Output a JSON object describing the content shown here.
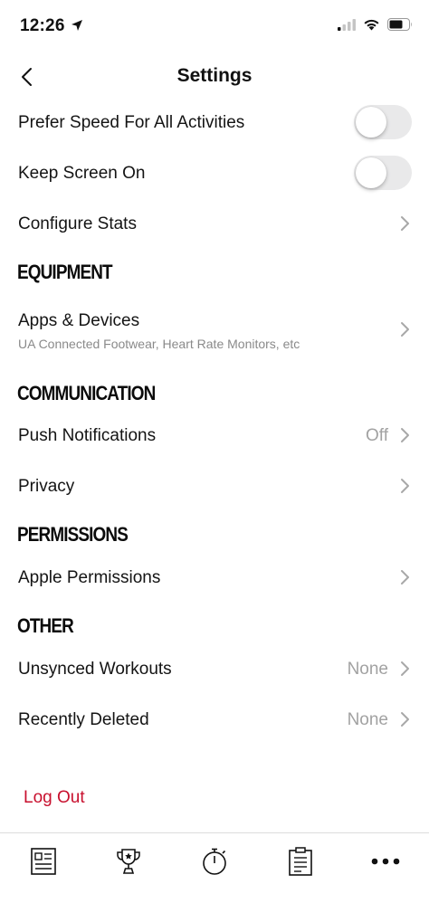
{
  "status_bar": {
    "time": "12:26"
  },
  "nav": {
    "title": "Settings"
  },
  "toggles": [
    {
      "label": "Prefer Speed For All Activities",
      "on": false
    },
    {
      "label": "Keep Screen On",
      "on": false
    }
  ],
  "configure_stats": {
    "label": "Configure Stats"
  },
  "sections": {
    "equipment": "EQUIPMENT",
    "communication": "COMMUNICATION",
    "permissions": "PERMISSIONS",
    "other": "OTHER"
  },
  "equipment": {
    "apps_devices": {
      "label": "Apps & Devices",
      "subtitle": "UA Connected Footwear, Heart Rate Monitors, etc"
    }
  },
  "communication": {
    "push_notifications": {
      "label": "Push Notifications",
      "value": "Off"
    },
    "privacy": {
      "label": "Privacy"
    }
  },
  "permissions": {
    "apple_permissions": {
      "label": "Apple Permissions"
    }
  },
  "other": {
    "unsynced_workouts": {
      "label": "Unsynced Workouts",
      "value": "None"
    },
    "recently_deleted": {
      "label": "Recently Deleted",
      "value": "None"
    }
  },
  "logout": {
    "label": "Log Out"
  },
  "tab_bar": [
    "feed-icon",
    "trophy-icon",
    "stopwatch-icon",
    "clipboard-icon",
    "more-icon"
  ],
  "colors": {
    "accent_red": "#c8102e",
    "toggle_off": "#e9e9ea",
    "secondary_text": "#a2a2a2"
  }
}
